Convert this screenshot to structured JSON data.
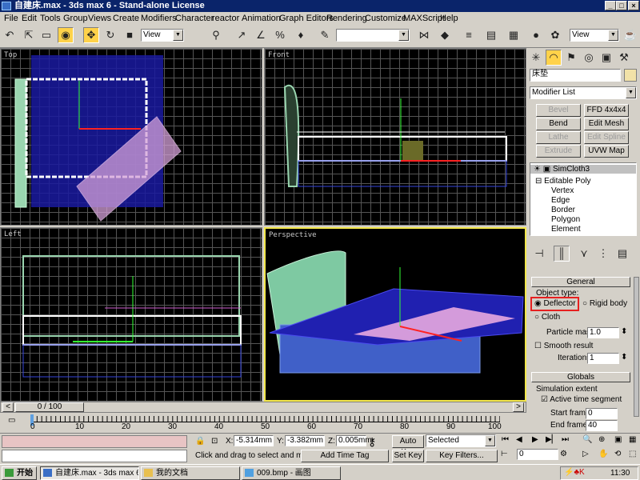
{
  "window": {
    "title": "自建床.max - 3ds max 6 - Stand-alone License"
  },
  "menu": [
    "File",
    "Edit",
    "Tools",
    "Group",
    "Views",
    "Create",
    "Modifiers",
    "Character",
    "reactor",
    "Animation",
    "Graph Editors",
    "Rendering",
    "Customize",
    "MAXScript",
    "Help"
  ],
  "toolbar": {
    "ref_coord": "View",
    "named_selection": "",
    "ref_coord_right": "View"
  },
  "viewports": {
    "top": "Top",
    "front": "Front",
    "left": "Left",
    "perspective": "Perspective"
  },
  "command_panel": {
    "object_name": "床垫",
    "modifier_list": "Modifier List",
    "buttons": [
      "Bevel",
      "FFD 4x4x4",
      "Bend",
      "Edit Mesh",
      "Lathe",
      "Edit Spline",
      "Extrude",
      "UVW Map"
    ],
    "stack": [
      "SimCloth3",
      "Editable Poly",
      "Vertex",
      "Edge",
      "Border",
      "Polygon",
      "Element"
    ],
    "general": {
      "title": "General",
      "object_type": "Object type:",
      "deflector": "Deflector",
      "rigid_body": "Rigid body",
      "cloth": "Cloth",
      "particle_mass_label": "Particle mass",
      "particle_mass": "1.0",
      "smooth_result": "Smooth result",
      "iterations_label": "Iterations",
      "iterations": "1"
    },
    "globals": {
      "title": "Globals",
      "sim_extent": "Simulation extent",
      "active_time": "Active time segment",
      "start_label": "Start frame",
      "start": "0",
      "end_label": "End frame",
      "end": "40"
    }
  },
  "timeline": {
    "slider": "0 / 100",
    "ticks": [
      "0",
      "10",
      "20",
      "30",
      "40",
      "50",
      "60",
      "70",
      "80",
      "90",
      "100"
    ]
  },
  "status": {
    "x": "-5.314mm",
    "y": "-3.382mm",
    "z": "0.005mm",
    "x_label": "X:",
    "y_label": "Y:",
    "z_label": "Z:",
    "prompt": "Click and drag to select and move",
    "add_time_tag": "Add Time Tag",
    "auto_key": "Auto Key",
    "selected": "Selected",
    "set_key": "Set Key",
    "key_filters": "Key Filters...",
    "frame": "0"
  },
  "taskbar": {
    "start": "开始",
    "tasks": [
      "自建床.max - 3ds max 6...",
      "我的文档",
      "009.bmp - 画图"
    ],
    "clock": "11:30"
  }
}
